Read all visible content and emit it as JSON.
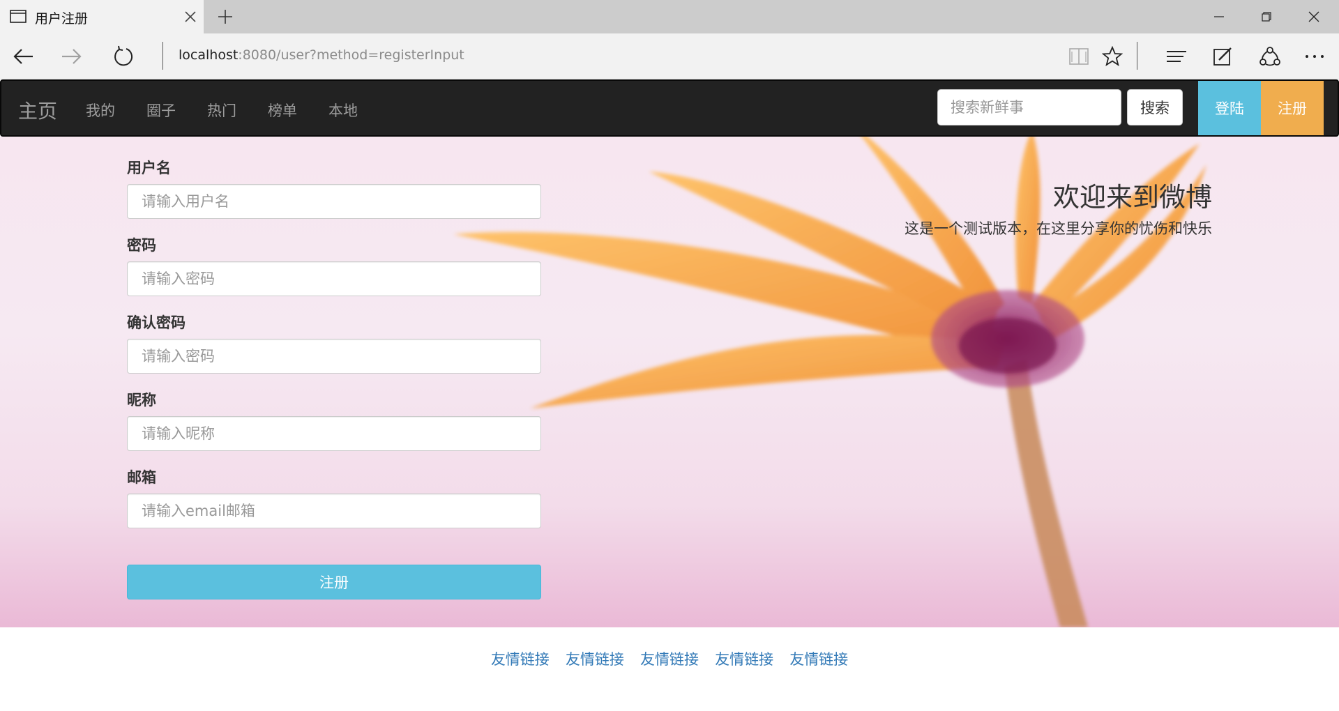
{
  "browser": {
    "tab_title": "用户注册",
    "url_host": "localhost",
    "url_rest": ":8080/user?method=registerInput"
  },
  "navbar": {
    "brand": "主页",
    "links": [
      "我的",
      "圈子",
      "热门",
      "榜单",
      "本地"
    ],
    "search_placeholder": "搜索新鲜事",
    "search_button": "搜索",
    "login_button": "登陆",
    "register_button": "注册",
    "login_color": "#5bc0de",
    "register_color": "#f0ad4e"
  },
  "form": {
    "username_label": "用户名",
    "username_placeholder": "请输入用户名",
    "password_label": "密码",
    "password_placeholder": "请输入密码",
    "confirm_label": "确认密码",
    "confirm_placeholder": "请输入密码",
    "nickname_label": "昵称",
    "nickname_placeholder": "请输入昵称",
    "email_label": "邮箱",
    "email_placeholder": "请输入email邮箱",
    "submit_label": "注册"
  },
  "hero": {
    "welcome_title": "欢迎来到微博",
    "welcome_subtitle": "这是一个测试版本，在这里分享你的忧伤和快乐"
  },
  "footer": {
    "links": [
      "友情链接",
      "友情链接",
      "友情链接",
      "友情链接",
      "友情链接"
    ]
  }
}
